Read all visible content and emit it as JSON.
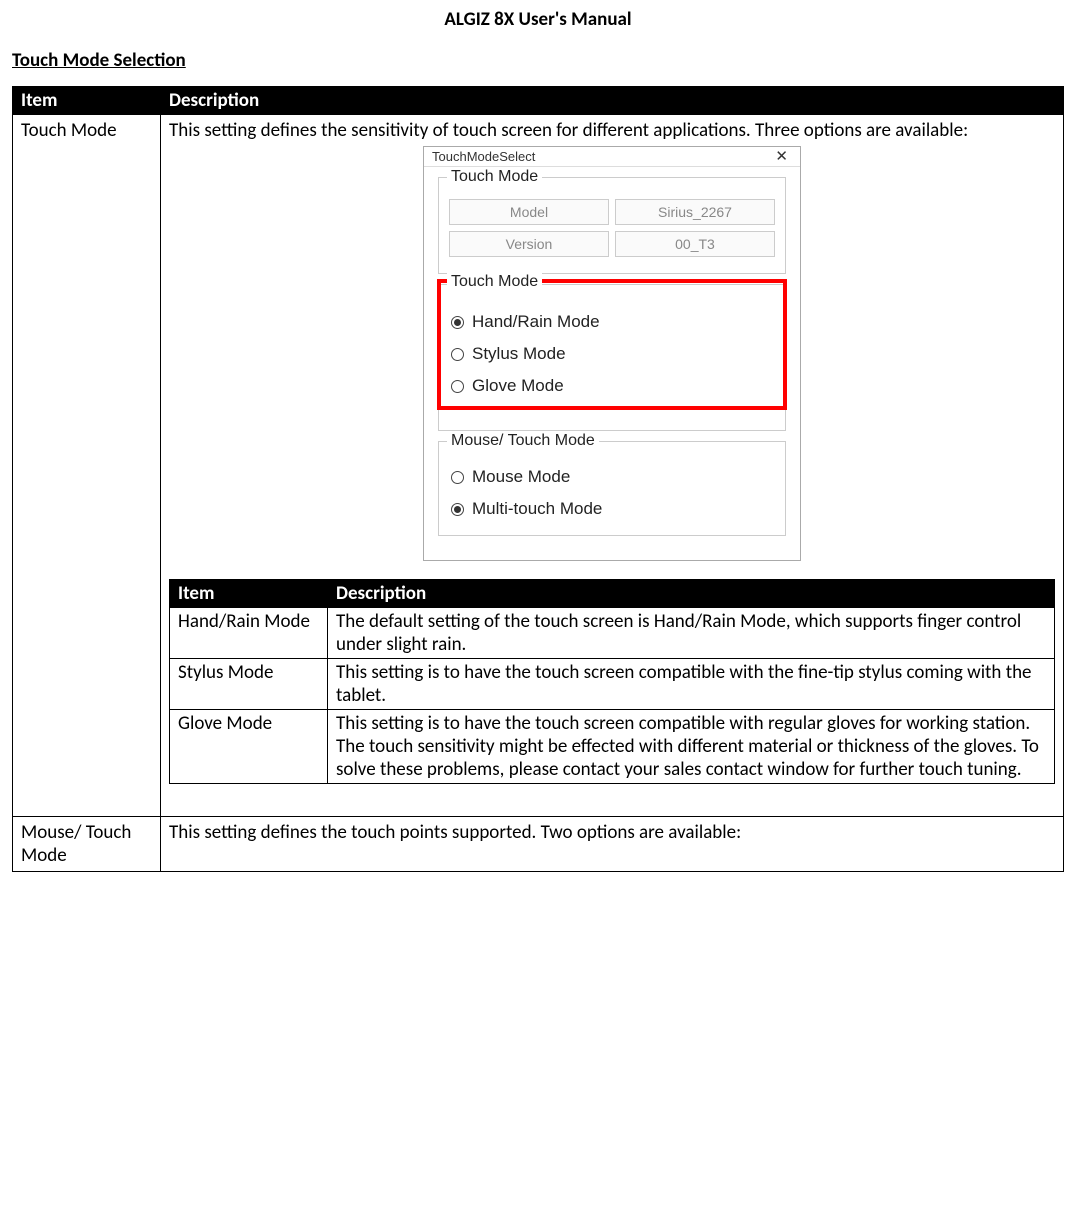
{
  "header_title": "ALGIZ 8X User's Manual",
  "section_title": "Touch Mode Selection",
  "outer_table": {
    "col_item": "Item",
    "col_desc": "Description",
    "rows": [
      {
        "item": "Touch Mode",
        "intro": "This setting defines the sensitivity of touch screen for different applications. Three options are available:"
      },
      {
        "item": "Mouse/ Touch Mode",
        "desc": "This setting defines the touch points supported. Two options are available:"
      }
    ]
  },
  "dialog": {
    "title": "TouchModeSelect",
    "close": "✕",
    "group_info": {
      "legend": "Touch Mode",
      "model_label": "Model",
      "model_value": "Sirius_2267",
      "version_label": "Version",
      "version_value": "00_T3"
    },
    "group_touch": {
      "legend": "Touch Mode",
      "options": [
        "Hand/Rain Mode",
        "Stylus Mode",
        "Glove Mode"
      ],
      "selected_index": 0
    },
    "group_mouse": {
      "legend": "Mouse/ Touch Mode",
      "options": [
        "Mouse Mode",
        "Multi-touch Mode"
      ],
      "selected_index": 1
    }
  },
  "inner_table": {
    "col_item": "Item",
    "col_desc": "Description",
    "rows": [
      {
        "item": "Hand/Rain Mode",
        "desc": "The default setting of the touch screen is Hand/Rain Mode, which supports finger control under slight rain."
      },
      {
        "item": "Stylus Mode",
        "desc": "This setting is to have the touch screen compatible with the fine-tip stylus coming with the tablet."
      },
      {
        "item": "Glove Mode",
        "desc": "This setting is to have the touch screen compatible with regular gloves for working station. The touch sensitivity might be effected with different material or thickness of the gloves. To solve these problems, please contact your sales contact window for further touch tuning."
      }
    ]
  }
}
